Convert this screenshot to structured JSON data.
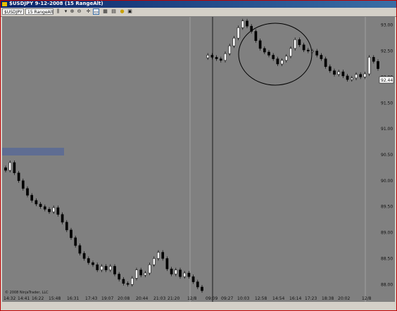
{
  "window": {
    "title": "$USDJPY  9-12-2008 (15 RangeAlt)"
  },
  "toolbar": {
    "instrument": "$USDJPY",
    "interval": "15 RangeAlt",
    "icons": [
      "bar-style-icon",
      "zoom-in-icon",
      "zoom-out-icon",
      "crosshair-icon",
      "drawing-tool-icon",
      "data-box-icon",
      "chart-properties-icon",
      "indicators-icon",
      "strategies-icon",
      "alert-icon"
    ]
  },
  "chart": {
    "copyright": "© 2008 NinjaTrader, LLC",
    "last_price_label": "92.44",
    "top_price_label": "93.00",
    "colors": {
      "background": "#808080",
      "up_candle": "#ffffff",
      "down_candle": "#000000",
      "wick": "#000000",
      "price_marker": "#ffffff",
      "shaded_box": "#5f6d92"
    }
  },
  "chart_data": {
    "type": "candlestick",
    "x_ticks": [
      "14:32",
      "14:41",
      "16:22",
      "15:48",
      "16:31",
      "17:43",
      "19:07",
      "20:08",
      "20:44",
      "21:03",
      "21:20",
      "12/8",
      "09:09",
      "09:27",
      "10:03",
      "12:58",
      "14:54",
      "16:14",
      "17:23",
      "18:38",
      "20:02",
      "12/8"
    ],
    "y_ticks": [
      "93.00",
      "92.50",
      "92.00",
      "91.50",
      "91.00",
      "90.50",
      "90.00",
      "89.50",
      "89.00",
      "88.50",
      "88.00"
    ],
    "ylim": [
      87.8,
      93.05
    ],
    "closes": [
      90.2,
      90.35,
      90.15,
      90.0,
      89.85,
      89.72,
      89.62,
      89.55,
      89.5,
      89.45,
      89.4,
      89.48,
      89.35,
      89.2,
      89.05,
      88.9,
      88.75,
      88.6,
      88.5,
      88.42,
      88.38,
      88.28,
      88.35,
      88.28,
      88.35,
      88.2,
      88.1,
      88.02,
      88.0,
      88.12,
      88.28,
      88.18,
      88.22,
      88.38,
      88.5,
      88.62,
      88.5,
      88.3,
      88.2,
      88.28,
      88.15,
      88.22,
      88.15,
      88.05,
      87.95,
      87.88,
      92.42,
      92.38,
      92.35,
      92.32,
      92.45,
      92.6,
      92.75,
      92.95,
      93.08,
      92.98,
      92.88,
      92.7,
      92.55,
      92.48,
      92.42,
      92.35,
      92.25,
      92.32,
      92.4,
      92.55,
      92.72,
      92.62,
      92.52,
      92.5,
      92.5,
      92.42,
      92.35,
      92.2,
      92.12,
      92.05,
      92.1,
      92.02,
      91.95,
      91.98,
      92.05,
      92.0,
      92.06,
      92.38,
      92.3,
      92.16
    ],
    "vertical_lines": [
      "12/8",
      "09:09",
      "12/8"
    ],
    "annotations": [
      "ellipse around 12:58–16:14 range",
      "shaded rectangle near 91.0"
    ]
  }
}
